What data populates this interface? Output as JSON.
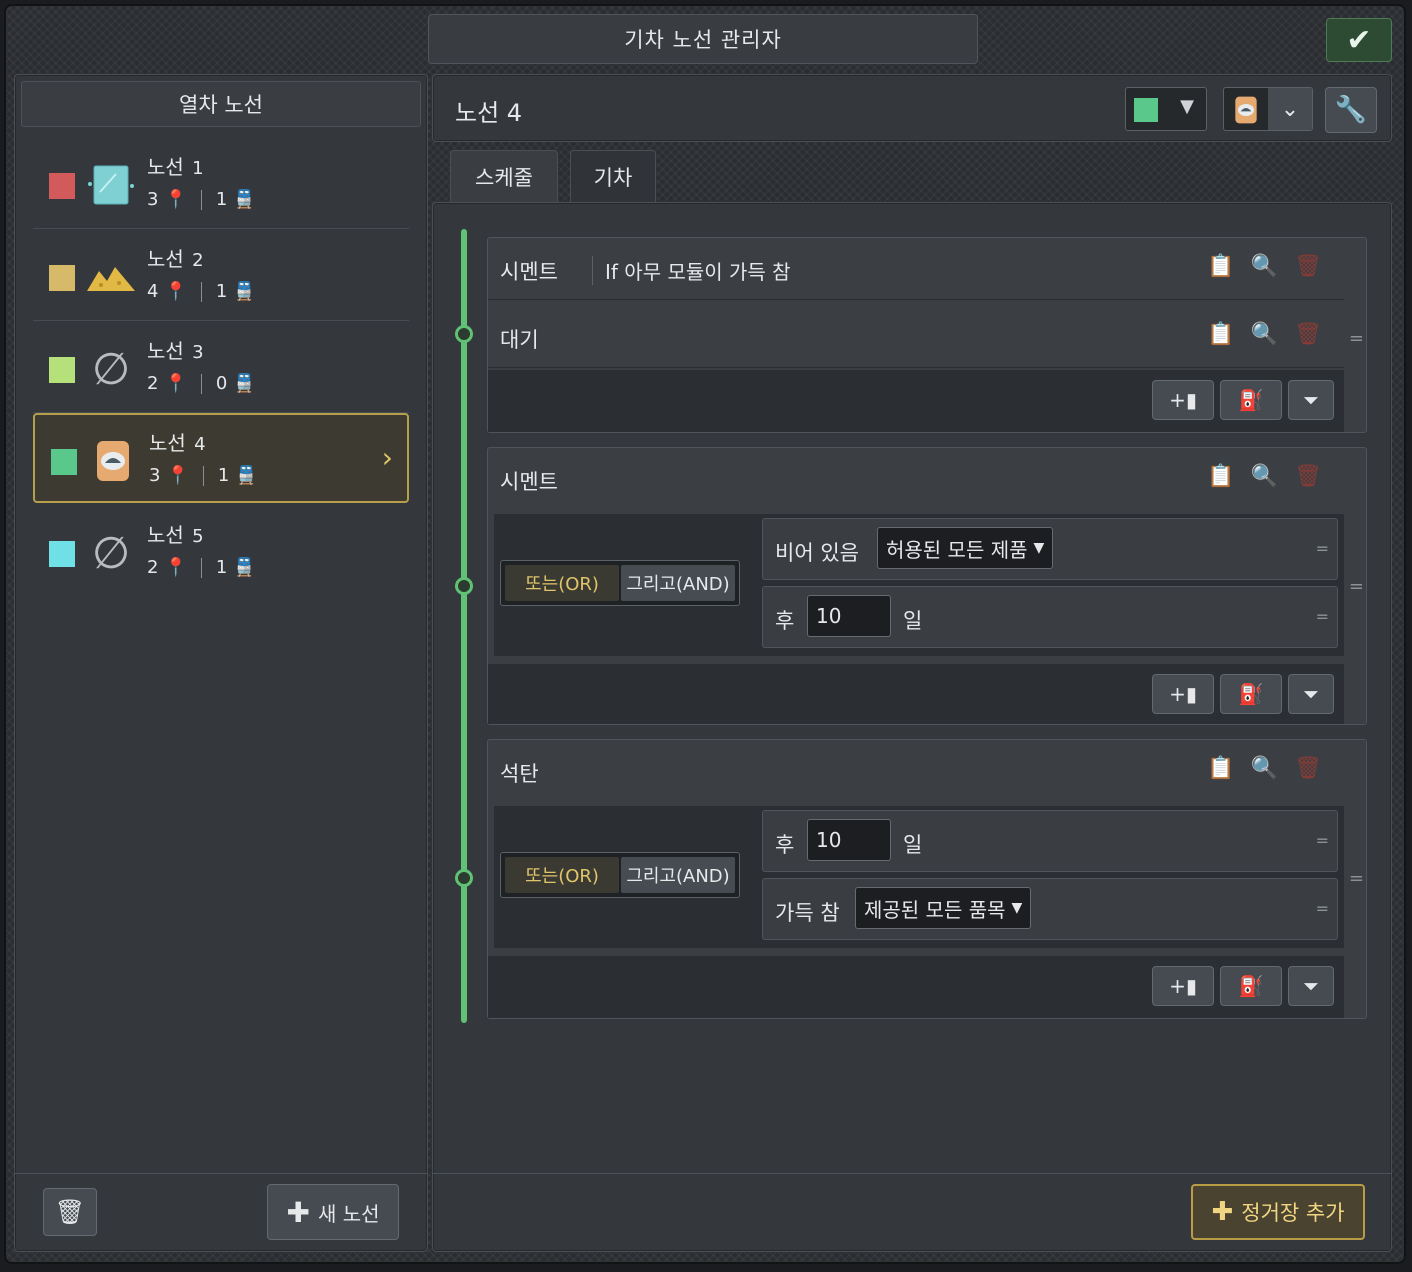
{
  "window": {
    "title": "기차 노선 관리자",
    "confirm_icon": "checkmark-icon"
  },
  "sidebar": {
    "title": "열차 노선",
    "lines": [
      {
        "name": "노선",
        "num": "1",
        "color": "#d35a5a",
        "icon": "glass-icon",
        "stations": "3",
        "trains": "1"
      },
      {
        "name": "노선",
        "num": "2",
        "color": "#d7b96a",
        "icon": "sand-icon",
        "stations": "4",
        "trains": "1"
      },
      {
        "name": "노선",
        "num": "3",
        "color": "#b6e07a",
        "icon": "empty-set-icon",
        "stations": "2",
        "trains": "0"
      },
      {
        "name": "노선",
        "num": "4",
        "color": "#59c88a",
        "icon": "cement-bag-icon",
        "stations": "3",
        "trains": "1",
        "selected": true
      },
      {
        "name": "노선",
        "num": "5",
        "color": "#6fe0e6",
        "icon": "empty-set-icon",
        "stations": "2",
        "trains": "1"
      }
    ],
    "new_line_label": "새 노선"
  },
  "route": {
    "title": "노선 4",
    "color": "#59c88a",
    "tabs": [
      "스케줄",
      "기차"
    ],
    "add_stop_label": "정거장 추가",
    "stops": [
      {
        "cargo": "시멘트",
        "condition": "If 아무 모듈이 가득 참",
        "wait_label": "대기"
      },
      {
        "cargo": "시멘트",
        "logic_or": "또는(OR)",
        "logic_and": "그리고(AND)",
        "conditions": [
          {
            "label": "비어 있음",
            "dropdown": "허용된 모든 제품"
          },
          {
            "label": "후",
            "value": "10",
            "unit": "일"
          }
        ]
      },
      {
        "cargo": "석탄",
        "logic_or": "또는(OR)",
        "logic_and": "그리고(AND)",
        "conditions": [
          {
            "label": "후",
            "value": "10",
            "unit": "일"
          },
          {
            "label": "가득 참",
            "dropdown": "제공된 모든 품목"
          }
        ]
      }
    ]
  }
}
